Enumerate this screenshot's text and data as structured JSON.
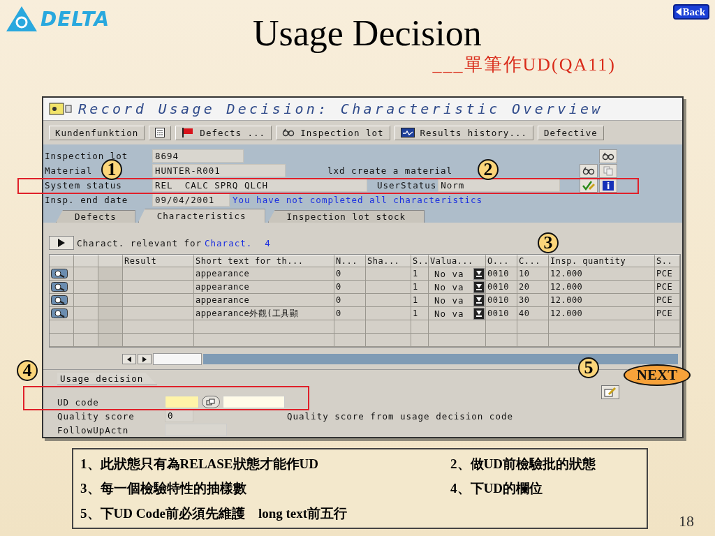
{
  "logo": {
    "text": "DELTA"
  },
  "back_button": {
    "label": "Back"
  },
  "title": "Usage Decision",
  "subtitle": "___單筆作UD(QA11)",
  "sap": {
    "title": "Record Usage Decision: Characteristic Overview",
    "toolbar": [
      {
        "kind": "text",
        "label": "Kundenfunktion"
      },
      {
        "kind": "calculator"
      },
      {
        "kind": "flag",
        "label": "Defects ..."
      },
      {
        "kind": "glasses",
        "label": "Inspection lot"
      },
      {
        "kind": "chart",
        "label": "Results history..."
      },
      {
        "kind": "text",
        "label": "Defective"
      }
    ],
    "header_fields": [
      {
        "label": "Inspection lot",
        "value": "8694"
      },
      {
        "label": "Material",
        "value": "HUNTER-R001",
        "note": "lxd create a material"
      },
      {
        "label": "System status",
        "value": "REL  CALC SPRQ QLCH",
        "extra_label": "UserStatus",
        "extra_value": "Norm"
      },
      {
        "label": "Insp. end date",
        "value": "09/04/2001",
        "message": "You have not completed all characteristics"
      }
    ],
    "tabs": [
      {
        "label": "Defects",
        "selected": false
      },
      {
        "label": "Characteristics",
        "selected": true
      },
      {
        "label": "Inspection lot stock",
        "selected": false
      }
    ],
    "filter": {
      "label": "Charact. relevant for",
      "field_label": "Charact.",
      "value": "4"
    },
    "table": {
      "columns": [
        "Result",
        "Short text for th...",
        "N...",
        "Sha...",
        "S..",
        "Valua...",
        "O...",
        "C...",
        "Insp. quantity",
        "S.."
      ],
      "rows": [
        {
          "short_text": "appearance",
          "n": "0",
          "s": "1",
          "valuation": "No va",
          "op": "0010",
          "char": "10",
          "quantity": "12.000",
          "unit": "PCE"
        },
        {
          "short_text": "appearance",
          "n": "0",
          "s": "1",
          "valuation": "No va",
          "op": "0010",
          "char": "20",
          "quantity": "12.000",
          "unit": "PCE"
        },
        {
          "short_text": "appearance",
          "n": "0",
          "s": "1",
          "valuation": "No va",
          "op": "0010",
          "char": "30",
          "quantity": "12.000",
          "unit": "PCE"
        },
        {
          "short_text": "appearance外觀(工具顯",
          "n": "0",
          "s": "1",
          "valuation": "No va",
          "op": "0010",
          "char": "40",
          "quantity": "12.000",
          "unit": "PCE"
        }
      ]
    },
    "usage_decision": {
      "tab": "Usage decision",
      "ud_code_label": "UD code",
      "quality_score_label": "Quality score",
      "quality_score": "0",
      "quality_text": "Quality score from usage decision code",
      "follow_up_label": "FollowUpActn"
    }
  },
  "callouts": [
    "1",
    "2",
    "3",
    "4",
    "5"
  ],
  "next_button": {
    "label": "NEXT"
  },
  "notes": [
    {
      "left": "1、此狀態只有為RELASE狀態才能作UD",
      "right": "2、做UD前檢驗批的狀態"
    },
    {
      "left": "3、每一個檢驗特性的抽樣數",
      "right": "4、下UD的欄位"
    },
    {
      "left": "5、下UD Code前必須先維護　long text前五行"
    }
  ],
  "page_number": "18"
}
